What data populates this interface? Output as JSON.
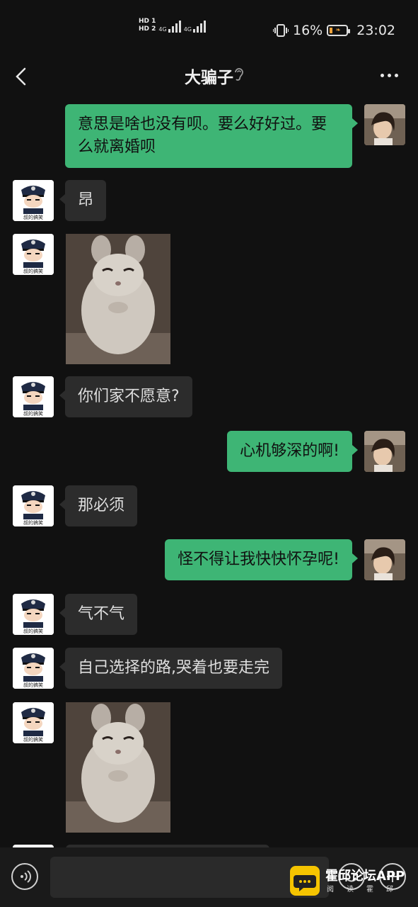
{
  "status_bar": {
    "sim1": "HD 1",
    "sim2": "HD 2",
    "network1": "4G",
    "network2": "4G",
    "battery_percent": "16%",
    "battery_level": 0.16,
    "time": "23:02"
  },
  "header": {
    "title": "大骗子"
  },
  "messages": [
    {
      "side": "right",
      "type": "text",
      "text": "意思是啥也没有呗。要么好好过。要么就离婚呗"
    },
    {
      "side": "left",
      "type": "text",
      "text": "昂"
    },
    {
      "side": "left",
      "type": "sticker",
      "sticker": "chinchilla-sticker"
    },
    {
      "side": "left",
      "type": "text",
      "text": "你们家不愿意?"
    },
    {
      "side": "right",
      "type": "text",
      "text": "心机够深的啊!"
    },
    {
      "side": "left",
      "type": "text",
      "text": "那必须"
    },
    {
      "side": "right",
      "type": "text",
      "text": "怪不得让我快快怀孕呢!"
    },
    {
      "side": "left",
      "type": "text",
      "text": "气不气"
    },
    {
      "side": "left",
      "type": "text",
      "text": "自己选择的路,哭着也要走完"
    },
    {
      "side": "left",
      "type": "sticker",
      "sticker": "chinchilla-sticker"
    }
  ],
  "avatar_left_caption": "叔的搞笑",
  "watermark": {
    "title": "霍邱论坛APP",
    "subtitle": "阅读霍邱"
  },
  "colors": {
    "background": "#111111",
    "bubble_right": "#3eb575",
    "bubble_left": "#2c2c2c",
    "input_bar": "#1a1a1a",
    "battery_accent": "#f0a33b"
  }
}
